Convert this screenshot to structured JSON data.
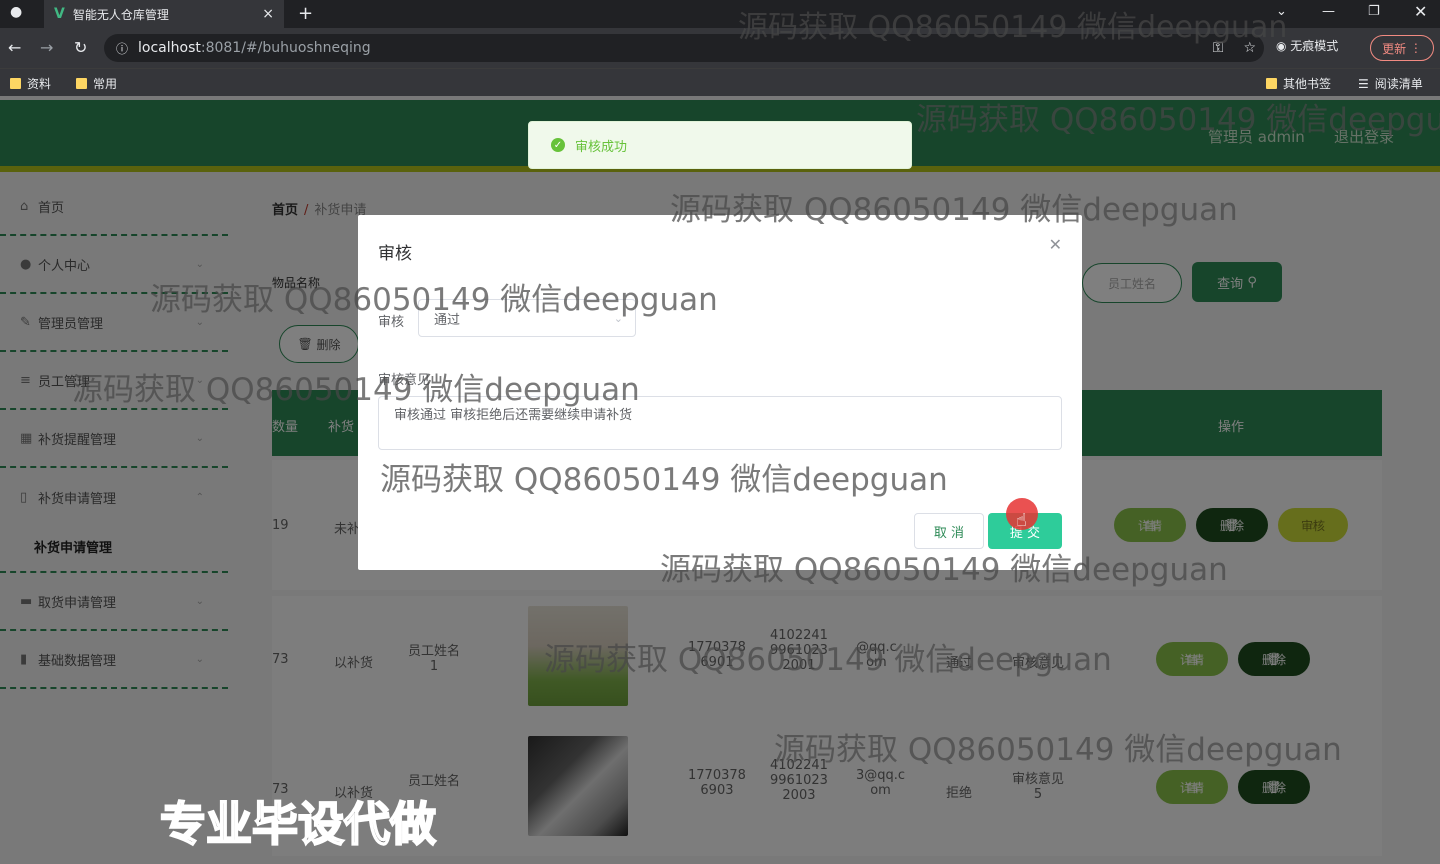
{
  "browser": {
    "tab_title": "智能无人仓库管理",
    "url_host": "localhost",
    "url_path": ":8081/#/buhuoshneqing",
    "incognito_label": "无痕模式",
    "update_label": "更新",
    "bookmarks": [
      "资料",
      "常用"
    ],
    "other_bookmarks": "其他书签",
    "reading_list": "阅读清单"
  },
  "header": {
    "admin_label": "管理员 admin",
    "logout_label": "退出登录"
  },
  "sidebar": {
    "items": [
      {
        "icon": "home-icon",
        "label": "首页"
      },
      {
        "icon": "user-icon",
        "label": "个人中心"
      },
      {
        "icon": "edit-icon",
        "label": "管理员管理"
      },
      {
        "icon": "list-icon",
        "label": "员工管理"
      },
      {
        "icon": "calendar-icon",
        "label": "补货提醒管理"
      },
      {
        "icon": "phone-icon",
        "label": "补货申请管理"
      },
      {
        "icon": "box-icon",
        "label": "取货申请管理"
      },
      {
        "icon": "chart-icon",
        "label": "基础数据管理"
      }
    ],
    "submenu_active": "补货申请管理"
  },
  "breadcrumb": {
    "home": "首页",
    "sep": "/",
    "current": "补货申请"
  },
  "toolbar": {
    "search_label": "物品名称",
    "employee_placeholder": "员工姓名",
    "query_label": "查询",
    "delete_label": "删除"
  },
  "table": {
    "headers": [
      "数量",
      "补货",
      "操作"
    ],
    "rows": [
      {
        "qty": "19",
        "status": "未补",
        "actions": [
          "详情",
          "删除",
          "审核"
        ]
      },
      {
        "qty": "73",
        "status": "以补货",
        "employee": "员工姓名\n1",
        "phone": "1770378\n6901",
        "idcard": "4102241\n9961023\n2001",
        "email": "@qq.c\nom",
        "result": "通过",
        "opinion": "审核意见",
        "actions": [
          "详情",
          "删除"
        ]
      },
      {
        "qty": "73",
        "status": "以补货",
        "employee": "员工姓名",
        "phone": "1770378\n6903",
        "idcard": "4102241\n9961023\n2003",
        "email": "3@qq.c\nom",
        "result": "拒绝",
        "opinion": "审核意见\n5",
        "actions": [
          "详情",
          "删除"
        ]
      }
    ]
  },
  "toast": {
    "message": "审核成功"
  },
  "dialog": {
    "title": "审核",
    "field_audit_label": "审核",
    "field_audit_value": "通过",
    "field_opinion_label": "审核意见",
    "field_opinion_value": "审核通过 审核拒绝后还需要继续申请补货",
    "cancel_label": "取 消",
    "submit_label": "提 交"
  },
  "watermark": "源码获取 QQ86050149 微信deepguan",
  "promo": "专业毕设代做",
  "colors": {
    "primary": "#2e8b57",
    "accent": "#b5c41b",
    "success": "#67c23a"
  }
}
